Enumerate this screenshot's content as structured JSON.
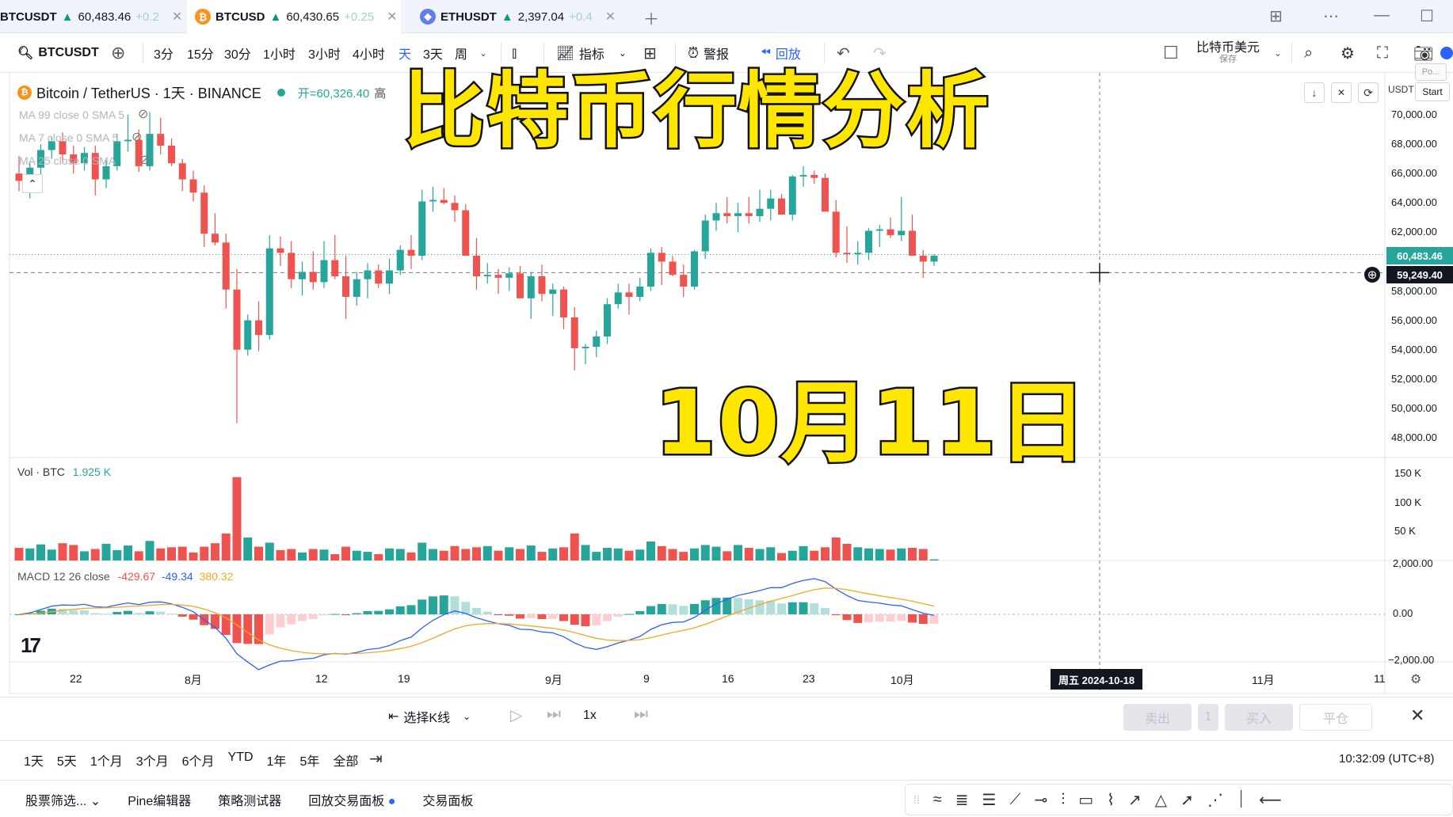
{
  "tabs": [
    {
      "symbol": "BTCUSDT",
      "arrow": "▲",
      "price": "60,483.46",
      "change": "+0.2"
    },
    {
      "symbol": "BTCUSD",
      "arrow": "▲",
      "price": "60,430.65",
      "change": "+0.25"
    },
    {
      "symbol": "ETHUSDT",
      "arrow": "▲",
      "price": "2,397.04",
      "change": "+0.4"
    }
  ],
  "toolbar": {
    "symbol": "BTCUSDT",
    "intervals": [
      "3分",
      "15分",
      "30分",
      "1小时",
      "3小时",
      "4小时",
      "天",
      "3天",
      "周"
    ],
    "active_interval": "天",
    "indicators": "指标",
    "alert": "警报",
    "replay": "回放",
    "currency": "比特币美元",
    "currency_sub": "保存"
  },
  "chart_header": {
    "title": "Bitcoin / TetherUS · 1天 · BINANCE",
    "open_label": "开=60,326.40",
    "high_label": "高",
    "usdt": "USDT",
    "start": "Start",
    "po": "Po..."
  },
  "legends": {
    "ma99": "MA 99 close 0 SMA 5",
    "ma7": "MA 7 close 0 SMA 5",
    "ma25": "MA 25 close 0 SMA",
    "vol_label": "Vol · BTC",
    "vol_value": "1.925 K",
    "macd_label": "MACD 12 26 close",
    "macd_v1": "-429.67",
    "macd_v2": "-49.34",
    "macd_v3": "380.32"
  },
  "overlay": {
    "title": "比特币行情分析",
    "date": "10月11日"
  },
  "price_axis": [
    "70,000.00",
    "68,000.00",
    "66,000.00",
    "64,000.00",
    "62,000.00",
    "58,000.00",
    "56,000.00",
    "54,000.00",
    "52,000.00",
    "50,000.00",
    "48,000.00"
  ],
  "price_axis_values": [
    70000,
    68000,
    66000,
    64000,
    62000,
    58000,
    56000,
    54000,
    52000,
    50000,
    48000
  ],
  "last_price": "60,483.46",
  "crosshair_price": "59,249.40",
  "vol_axis": [
    "150 K",
    "100 K",
    "50 K"
  ],
  "macd_axis": [
    "2,000.00",
    "0.00",
    "−2,000.00"
  ],
  "time_axis": [
    "22",
    "8月",
    "12",
    "19",
    "9月",
    "9",
    "16",
    "23",
    "10月",
    "11月",
    "11"
  ],
  "crosshair_date": "周五 2024-10-18",
  "colors": {
    "up": "#26a69a",
    "down": "#ef5350",
    "accent": "#2962ff",
    "overlay_text": "#ffe600"
  },
  "chart_data": {
    "type": "candlestick",
    "symbol": "BTCUSDT",
    "interval": "1D",
    "ylim": [
      47000,
      71000
    ],
    "candles": [
      [
        66000,
        67200,
        64800,
        65500
      ],
      [
        65500,
        66800,
        64300,
        66400
      ],
      [
        66400,
        68000,
        65600,
        67600
      ],
      [
        67600,
        68500,
        67000,
        68200
      ],
      [
        68200,
        68800,
        66800,
        67300
      ],
      [
        67300,
        67900,
        66000,
        66700
      ],
      [
        66700,
        67800,
        66200,
        67400
      ],
      [
        67400,
        67900,
        64500,
        65600
      ],
      [
        65600,
        66900,
        65000,
        66500
      ],
      [
        66500,
        68700,
        66200,
        68200
      ],
      [
        68200,
        70000,
        67500,
        68300
      ],
      [
        68300,
        69000,
        66100,
        66500
      ],
      [
        66500,
        70200,
        66200,
        68700
      ],
      [
        68700,
        69800,
        67300,
        67900
      ],
      [
        67900,
        68400,
        66500,
        66700
      ],
      [
        66700,
        67000,
        64800,
        65600
      ],
      [
        65600,
        66200,
        64100,
        64700
      ],
      [
        64700,
        65200,
        61000,
        61900
      ],
      [
        61900,
        63300,
        61100,
        61300
      ],
      [
        61300,
        61900,
        56800,
        58100
      ],
      [
        58100,
        59500,
        49000,
        54000
      ],
      [
        54000,
        56400,
        53600,
        56000
      ],
      [
        56000,
        57300,
        53900,
        55000
      ],
      [
        55000,
        61800,
        54700,
        60900
      ],
      [
        60900,
        61700,
        59700,
        60600
      ],
      [
        60600,
        61400,
        58200,
        58800
      ],
      [
        58800,
        60000,
        57700,
        59300
      ],
      [
        59300,
        60700,
        58100,
        58600
      ],
      [
        58600,
        61400,
        58200,
        60100
      ],
      [
        60100,
        61800,
        58800,
        59000
      ],
      [
        59000,
        60400,
        56100,
        57600
      ],
      [
        57600,
        59300,
        57000,
        58800
      ],
      [
        58800,
        59900,
        57500,
        59400
      ],
      [
        59400,
        59800,
        58200,
        58500
      ],
      [
        58500,
        60200,
        57800,
        59400
      ],
      [
        59400,
        61100,
        59100,
        60800
      ],
      [
        60800,
        61800,
        59500,
        60400
      ],
      [
        60400,
        64900,
        60100,
        64100
      ],
      [
        64100,
        65100,
        63400,
        64200
      ],
      [
        64200,
        65000,
        63900,
        64000
      ],
      [
        64000,
        64500,
        62700,
        63500
      ],
      [
        63500,
        63900,
        60500,
        60400
      ],
      [
        60400,
        61600,
        58100,
        59000
      ],
      [
        59000,
        59900,
        58500,
        59100
      ],
      [
        59100,
        59500,
        57800,
        58900
      ],
      [
        58900,
        59600,
        58000,
        59200
      ],
      [
        59200,
        59700,
        57700,
        57500
      ],
      [
        57500,
        59300,
        56100,
        59000
      ],
      [
        59000,
        59800,
        57300,
        57800
      ],
      [
        57800,
        58500,
        56300,
        58100
      ],
      [
        58100,
        58300,
        55400,
        56200
      ],
      [
        56200,
        56900,
        52600,
        54100
      ],
      [
        54100,
        54400,
        53000,
        54200
      ],
      [
        54200,
        55300,
        53500,
        54900
      ],
      [
        54900,
        57500,
        54400,
        57100
      ],
      [
        57100,
        58500,
        56800,
        57900
      ],
      [
        57900,
        58500,
        56400,
        57600
      ],
      [
        57600,
        58900,
        57300,
        58300
      ],
      [
        58300,
        60900,
        58000,
        60600
      ],
      [
        60600,
        61000,
        58400,
        60000
      ],
      [
        60000,
        60400,
        59000,
        59100
      ],
      [
        59100,
        59800,
        57600,
        58300
      ],
      [
        58300,
        60800,
        58100,
        60700
      ],
      [
        60700,
        63200,
        60200,
        62800
      ],
      [
        62800,
        64000,
        62100,
        63300
      ],
      [
        63300,
        64400,
        62600,
        63100
      ],
      [
        63100,
        64000,
        62000,
        63300
      ],
      [
        63300,
        64400,
        62600,
        63100
      ],
      [
        63100,
        64900,
        62700,
        63600
      ],
      [
        63600,
        64900,
        62800,
        64300
      ],
      [
        64300,
        64600,
        63200,
        63200
      ],
      [
        63200,
        65900,
        62800,
        65800
      ],
      [
        65800,
        66500,
        65100,
        65900
      ],
      [
        65900,
        66200,
        65300,
        65700
      ],
      [
        65700,
        66000,
        63600,
        63400
      ],
      [
        63400,
        64200,
        60300,
        60600
      ],
      [
        60600,
        62400,
        59900,
        60500
      ],
      [
        60500,
        61400,
        59800,
        60600
      ],
      [
        60600,
        62300,
        60100,
        62100
      ],
      [
        62100,
        62500,
        61000,
        62200
      ],
      [
        62200,
        63000,
        61600,
        61800
      ],
      [
        61800,
        64400,
        61400,
        62100
      ],
      [
        62100,
        63200,
        60400,
        60400
      ],
      [
        60400,
        60800,
        58900,
        60000
      ],
      [
        60000,
        60500,
        59700,
        60400
      ]
    ],
    "volume": [
      22,
      21,
      28,
      19,
      30,
      27,
      16,
      20,
      29,
      18,
      26,
      16,
      34,
      21,
      23,
      24,
      14,
      24,
      30,
      47,
      145,
      40,
      24,
      31,
      18,
      20,
      14,
      20,
      19,
      11,
      24,
      17,
      15,
      11,
      21,
      20,
      14,
      31,
      20,
      17,
      25,
      20,
      23,
      25,
      17,
      23,
      20,
      26,
      15,
      21,
      23,
      47,
      27,
      15,
      22,
      21,
      17,
      19,
      33,
      25,
      20,
      15,
      21,
      27,
      24,
      16,
      27,
      22,
      20,
      23,
      13,
      17,
      25,
      17,
      23,
      40,
      29,
      23,
      21,
      20,
      19,
      21,
      22,
      20,
      2
    ]
  }
}
